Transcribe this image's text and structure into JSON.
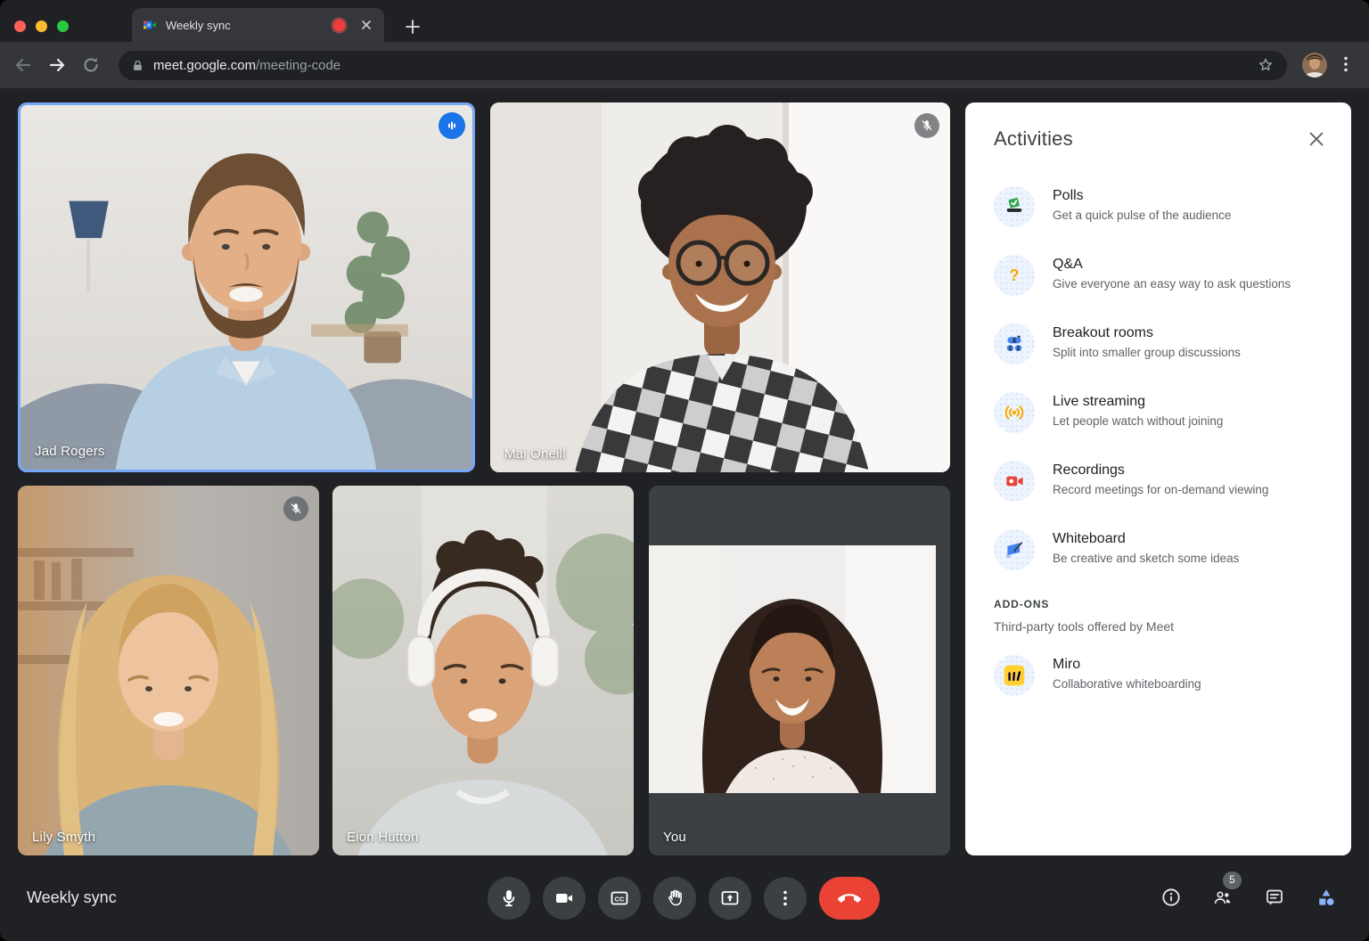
{
  "browser": {
    "tab_title": "Weekly sync",
    "url": {
      "host": "meet.google.com",
      "path": "/meeting-code"
    }
  },
  "meeting": {
    "title": "Weekly sync",
    "participants": [
      {
        "name": "Jad Rogers",
        "indicator": "speaking"
      },
      {
        "name": "Mai Oneill",
        "indicator": "muted"
      },
      {
        "name": "Lily Smyth",
        "indicator": "muted"
      },
      {
        "name": "Eion Hutton",
        "indicator": "none"
      },
      {
        "name": "You",
        "indicator": "none"
      }
    ],
    "participants_count_badge": "5",
    "captions_label": "CC"
  },
  "activities": {
    "title": "Activities",
    "items": [
      {
        "title": "Polls",
        "subtitle": "Get a quick pulse of the audience",
        "icon": "polls-icon"
      },
      {
        "title": "Q&A",
        "subtitle": "Give everyone an easy way to ask questions",
        "icon": "qa-icon"
      },
      {
        "title": "Breakout rooms",
        "subtitle": "Split into smaller group discussions",
        "icon": "breakout-rooms-icon"
      },
      {
        "title": "Live streaming",
        "subtitle": "Let people watch without joining",
        "icon": "live-streaming-icon"
      },
      {
        "title": "Recordings",
        "subtitle": "Record meetings for on-demand viewing",
        "icon": "recordings-icon"
      },
      {
        "title": "Whiteboard",
        "subtitle": "Be creative and sketch some ideas",
        "icon": "whiteboard-icon"
      }
    ],
    "addons_header": "ADD-ONS",
    "addons_subtitle": "Third-party tools offered by Meet",
    "addons": [
      {
        "title": "Miro",
        "subtitle": "Collaborative whiteboarding",
        "icon": "miro-icon"
      }
    ]
  },
  "colors": {
    "accent_blue": "#8ab4f8",
    "speaking_blue": "#1a73e8",
    "end_call_red": "#ea4335",
    "recording_red": "#f43b3b",
    "chrome_toolbar": "#35363a",
    "page_bg": "#202124",
    "panel_bg": "#ffffff"
  }
}
